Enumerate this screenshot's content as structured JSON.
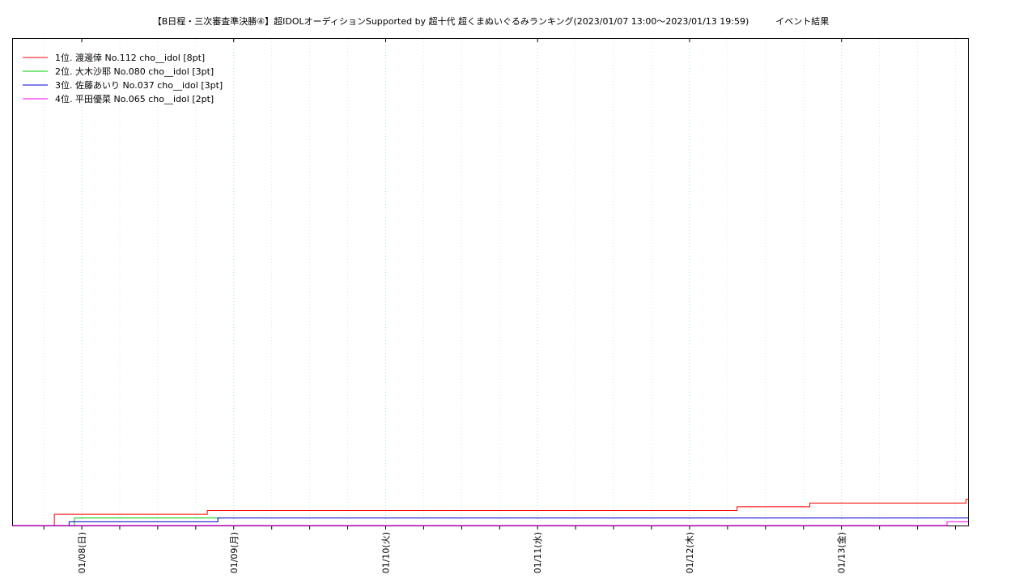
{
  "chart_data": {
    "type": "line",
    "step": true,
    "title": "【B日程・三次審査準決勝④】超IDOLオーディションSupported by 超十代 超くまぬいぐるみランキング(2023/01/07 13:00～2023/01/13 19:59)　　　イベント結果",
    "xlabel": "",
    "ylabel": "",
    "x_range": [
      "2023-01-07 13:00",
      "2023-01-13 19:59"
    ],
    "ylim": [
      0,
      130
    ],
    "grid": true,
    "legend_position": "top-left",
    "x_ticks": [
      {
        "x": "2023-01-08 00:00",
        "label": "01/08(日)"
      },
      {
        "x": "2023-01-09 00:00",
        "label": "01/09(月)"
      },
      {
        "x": "2023-01-10 00:00",
        "label": "01/10(火)"
      },
      {
        "x": "2023-01-11 00:00",
        "label": "01/11(水)"
      },
      {
        "x": "2023-01-12 00:00",
        "label": "01/12(木)"
      },
      {
        "x": "2023-01-13 00:00",
        "label": "01/13(金)"
      }
    ],
    "series": [
      {
        "name": "1位. 渡邊倖 No.112 cho__idol [8pt]",
        "color": "#ff0000",
        "points": [
          {
            "x": "2023-01-07 13:00",
            "y": 0
          },
          {
            "x": "2023-01-07 19:40",
            "y": 3
          },
          {
            "x": "2023-01-08 19:50",
            "y": 4
          },
          {
            "x": "2023-01-12 07:30",
            "y": 5
          },
          {
            "x": "2023-01-12 19:00",
            "y": 6
          },
          {
            "x": "2023-01-13 19:40",
            "y": 7
          },
          {
            "x": "2023-01-13 19:59",
            "y": 7
          }
        ]
      },
      {
        "name": "2位. 大木沙耶 No.080 cho__idol [3pt]",
        "color": "#00cc00",
        "points": [
          {
            "x": "2023-01-07 13:00",
            "y": 0
          },
          {
            "x": "2023-01-07 22:50",
            "y": 2
          },
          {
            "x": "2023-01-08 21:50",
            "y": 2
          }
        ]
      },
      {
        "name": "3位. 佐藤あいり No.037 cho__idol [3pt]",
        "color": "#0000cc",
        "points": [
          {
            "x": "2023-01-07 13:00",
            "y": 0
          },
          {
            "x": "2023-01-07 22:00",
            "y": 1
          },
          {
            "x": "2023-01-08 21:30",
            "y": 2
          },
          {
            "x": "2023-01-13 19:59",
            "y": 2
          }
        ]
      },
      {
        "name": "4位. 平田優菜 No.065 cho__idol [2pt]",
        "color": "#ff00ff",
        "points": [
          {
            "x": "2023-01-07 13:00",
            "y": 0
          },
          {
            "x": "2023-01-13 16:40",
            "y": 1
          },
          {
            "x": "2023-01-13 19:59",
            "y": 1
          }
        ]
      }
    ]
  }
}
